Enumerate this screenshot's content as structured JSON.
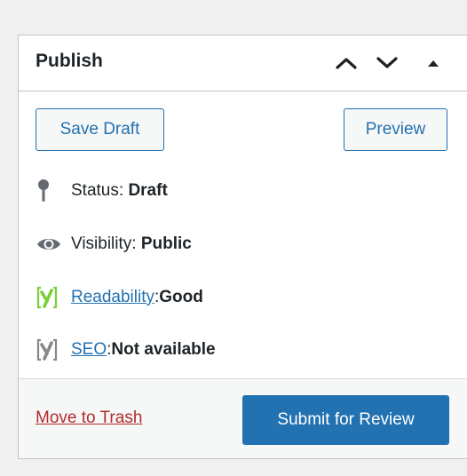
{
  "header": {
    "title": "Publish",
    "move_up_icon": "chevron-up-icon",
    "move_down_icon": "chevron-down-icon",
    "toggle_icon": "caret-up-icon"
  },
  "actions": {
    "save_draft": "Save Draft",
    "preview": "Preview"
  },
  "status": {
    "icon": "pin-icon",
    "label": "Status: ",
    "value": "Draft"
  },
  "visibility": {
    "icon": "eye-icon",
    "label": "Visibility: ",
    "value": "Public"
  },
  "readability": {
    "icon": "yoast-icon",
    "link": "Readability",
    "separator": ": ",
    "value": "Good",
    "color": "#7ad03a"
  },
  "seo": {
    "icon": "yoast-icon",
    "link": "SEO",
    "separator": ": ",
    "value": "Not available",
    "color": "#888888"
  },
  "footer": {
    "trash": "Move to Trash",
    "submit": "Submit for Review"
  },
  "colors": {
    "accent": "#2271b1",
    "danger": "#b32d2e",
    "border": "#c3c4c7"
  }
}
